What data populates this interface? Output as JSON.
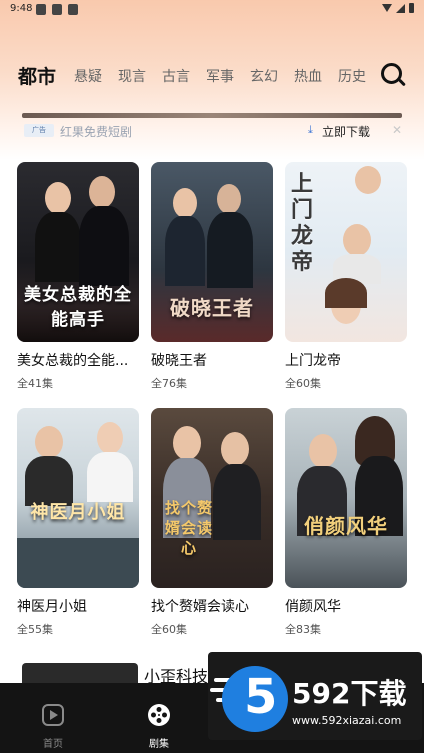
{
  "status_bar": {
    "time": "9:48"
  },
  "tabs": [
    {
      "label": "都市",
      "active": true
    },
    {
      "label": "悬疑",
      "active": false
    },
    {
      "label": "现言",
      "active": false
    },
    {
      "label": "古言",
      "active": false
    },
    {
      "label": "军事",
      "active": false
    },
    {
      "label": "玄幻",
      "active": false
    },
    {
      "label": "热血",
      "active": false
    },
    {
      "label": "历史",
      "active": false
    }
  ],
  "ad": {
    "logo_text": "广告",
    "app_name": "红果免费短剧",
    "download_label": "立即下载",
    "close_glyph": "✕"
  },
  "dramas": [
    {
      "title": "美女总裁的全能...",
      "count": "全41集",
      "poster_text": "美女总裁的全能高手"
    },
    {
      "title": "破晓王者",
      "count": "全76集",
      "poster_text": "破晓王者"
    },
    {
      "title": "上门龙帝",
      "count": "全60集",
      "poster_text": "上门龙帝"
    },
    {
      "title": "神医月小姐",
      "count": "全55集",
      "poster_text": "神医月小姐"
    },
    {
      "title": "找个赘婿会读心",
      "count": "全60集",
      "poster_text": "找个赘婿会读心"
    },
    {
      "title": "俏颜风华",
      "count": "全83集",
      "poster_text": "俏颜风华"
    }
  ],
  "partial_item": {
    "text": "小歪科技"
  },
  "bottom_nav": [
    {
      "label": "首页",
      "icon": "play-icon",
      "active": false
    },
    {
      "label": "剧集",
      "icon": "film-reel-icon",
      "active": true
    }
  ],
  "watermark": {
    "digit": "5",
    "brand": "592下载",
    "url": "www.592xiazai.com"
  },
  "colors": {
    "accent_blue": "#1f7fe0",
    "nav_bg": "#141414",
    "header_gradient_top": "#f9c9ad"
  }
}
